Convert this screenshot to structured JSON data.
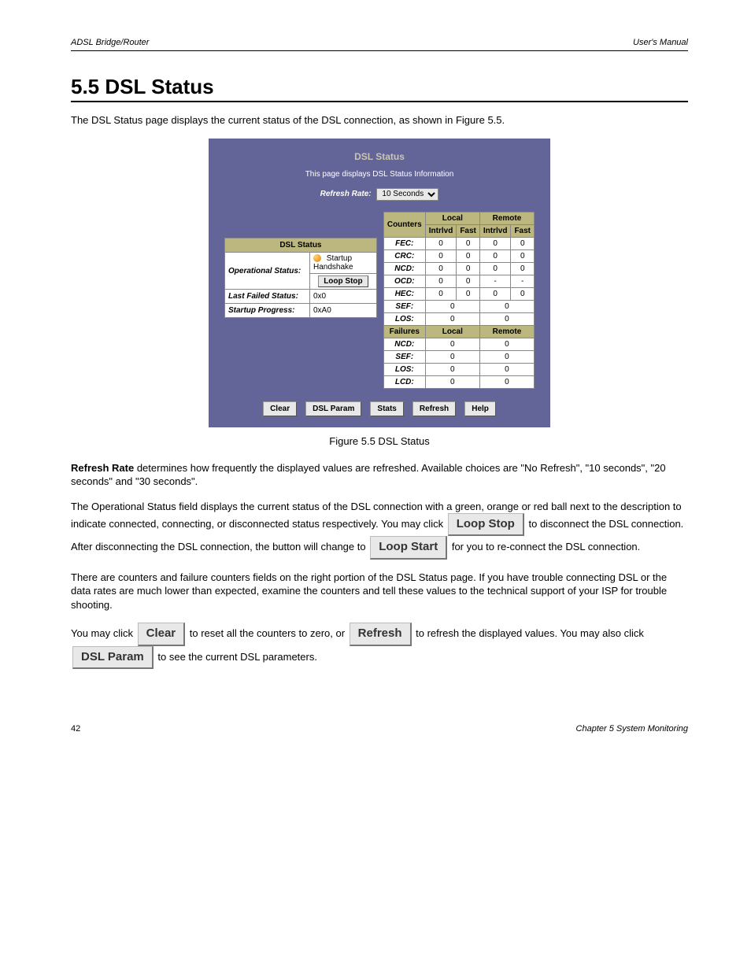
{
  "header": {
    "left": "ADSL Bridge/Router",
    "right": "User's Manual"
  },
  "section_title": "5.5 DSL Status",
  "intro": "The DSL Status page displays the current status of the DSL connection, as shown in Figure 5.5.",
  "panel": {
    "title": "DSL Status",
    "subtitle": "This page displays DSL Status Information",
    "refresh_label": "Refresh Rate:",
    "refresh_value": "10 Seconds",
    "status_table": {
      "header": "DSL Status",
      "rows": {
        "operational_label": "Operational Status:",
        "operational_value": "Startup Handshake",
        "loop_button": "Loop Stop",
        "lastfailed_label": "Last Failed Status:",
        "lastfailed_value": "0x0",
        "startup_label": "Startup Progress:",
        "startup_value": "0xA0"
      }
    },
    "counters_table": {
      "counters_head": "Counters",
      "local": "Local",
      "remote": "Remote",
      "intrlvd": "Intrlvd",
      "fast": "Fast",
      "rows": {
        "FEC": {
          "label": "FEC:",
          "li": "0",
          "lf": "0",
          "ri": "0",
          "rf": "0"
        },
        "CRC": {
          "label": "CRC:",
          "li": "0",
          "lf": "0",
          "ri": "0",
          "rf": "0"
        },
        "NCD": {
          "label": "NCD:",
          "li": "0",
          "lf": "0",
          "ri": "0",
          "rf": "0"
        },
        "OCD": {
          "label": "OCD:",
          "li": "0",
          "lf": "0",
          "ri": "-",
          "rf": "-"
        },
        "HEC": {
          "label": "HEC:",
          "li": "0",
          "lf": "0",
          "ri": "0",
          "rf": "0"
        },
        "SEF": {
          "label": "SEF:",
          "local": "0",
          "remote": "0"
        },
        "LOS": {
          "label": "LOS:",
          "local": "0",
          "remote": "0"
        }
      },
      "failures_head": "Failures",
      "failures": {
        "NCD": {
          "label": "NCD:",
          "local": "0",
          "remote": "0"
        },
        "SEF": {
          "label": "SEF:",
          "local": "0",
          "remote": "0"
        },
        "LOS": {
          "label": "LOS:",
          "local": "0",
          "remote": "0"
        },
        "LCD": {
          "label": "LCD:",
          "local": "0",
          "remote": "0"
        }
      }
    },
    "buttons": {
      "clear": "Clear",
      "dslparam": "DSL Param",
      "stats": "Stats",
      "refresh": "Refresh",
      "help": "Help"
    }
  },
  "figure_caption": "Figure 5.5  DSL Status",
  "para_refresh_highlighted": "Refresh Rate",
  "para_refresh_rest": " determines how frequently the displayed values are refreshed. Available choices are \"No Refresh\", \"10 seconds\", \"20 seconds\" and \"30 seconds\".",
  "para_opstatus": "The Operational Status field displays the current status of the DSL connection with a green, orange or red ball next to the description to indicate connected, connecting, or disconnected status respectively. You may click ",
  "para_opstatus_mid": " to disconnect the DSL connection. After disconnecting the DSL connection, the button will change to ",
  "para_opstatus_end": " for you to re-connect the DSL connection.",
  "lbl_loop_stop": "Loop Stop",
  "lbl_loop_start": "Loop Start",
  "para_counters_a": "There are counters and failure counters fields on the right portion of the DSL Status page. If you have trouble connecting DSL or the data rates are much lower than expected, examine the counters and tell these values to the technical support of your ISP for trouble shooting.",
  "para_bottom_pre": "You may click ",
  "lbl_clear": "Clear",
  "para_bottom_mid1": " to reset all the counters to zero, or ",
  "lbl_refresh": "Refresh",
  "para_bottom_mid2": " to refresh the displayed values. You may also click ",
  "lbl_dslparam": "DSL Param",
  "para_bottom_end": " to see the current DSL parameters.",
  "footer": {
    "left": "42",
    "right": "Chapter 5  System Monitoring"
  }
}
